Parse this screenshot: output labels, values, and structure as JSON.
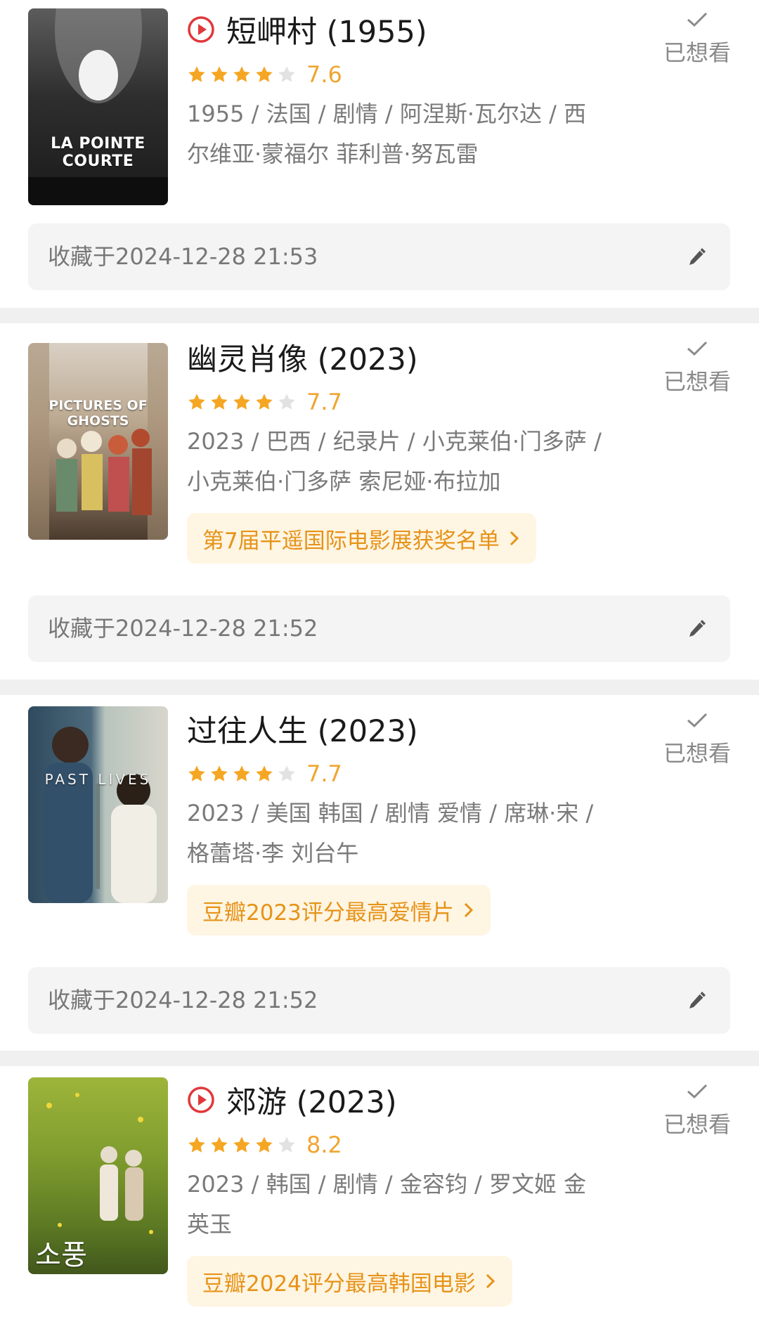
{
  "items": [
    {
      "title": "短岬村 (1955)",
      "has_play": true,
      "stars_filled": 4,
      "rating": "7.6",
      "meta": "1955 / 法国 / 剧情 / 阿涅斯·瓦尔达 / 西尔维亚·蒙福尔 菲利普·努瓦雷",
      "poster_text": "LA POINTE COURTE",
      "tag": null,
      "wish_label": "已想看",
      "collected": "收藏于2024-12-28 21:53"
    },
    {
      "title": "幽灵肖像 (2023)",
      "has_play": false,
      "stars_filled": 4,
      "rating": "7.7",
      "meta": "2023 / 巴西 / 纪录片 / 小克莱伯·门多萨 / 小克莱伯·门多萨 索尼娅·布拉加",
      "poster_text": "PICTURES OF GHOSTS",
      "tag": "第7届平遥国际电影展获奖名单",
      "wish_label": "已想看",
      "collected": "收藏于2024-12-28 21:52"
    },
    {
      "title": "过往人生 (2023)",
      "has_play": false,
      "stars_filled": 4,
      "rating": "7.7",
      "meta": "2023 / 美国 韩国 / 剧情 爱情 / 席琳·宋 / 格蕾塔·李 刘台午",
      "poster_text": "PAST LIVES",
      "tag": "豆瓣2023评分最高爱情片",
      "wish_label": "已想看",
      "collected": "收藏于2024-12-28 21:52"
    },
    {
      "title": "郊游 (2023)",
      "has_play": true,
      "stars_filled": 4,
      "rating": "8.2",
      "meta": "2023 / 韩国 / 剧情 / 金容钧 / 罗文姬 金英玉",
      "poster_text": "소풍",
      "tag": "豆瓣2024评分最高韩国电影",
      "wish_label": "已想看",
      "collected": null
    }
  ],
  "colors": {
    "star": "#f5a623",
    "star_empty": "#e2e2e2",
    "rating": "#f0a530",
    "tag_text": "#e69318",
    "tag_bg": "#fff5e3",
    "play": "#e0383b"
  }
}
